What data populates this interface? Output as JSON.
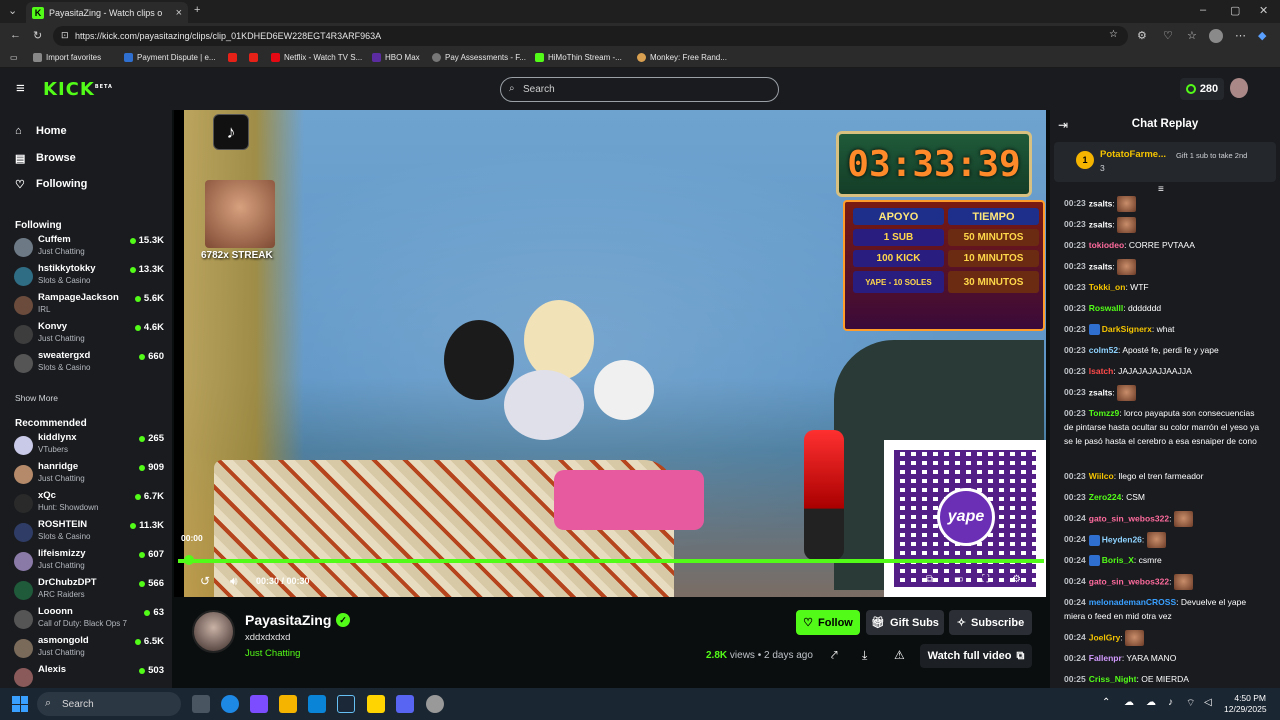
{
  "browser": {
    "tab_title": "PayasitaZing - Watch clips o",
    "url": "https://kick.com/payasitazing/clips/clip_01KDHED6EW228EGT4R3ARF963A",
    "favorites": [
      "Import favorites",
      "Payment Dispute | e...",
      "Netflix - Watch TV S...",
      "HBO Max",
      "Pay Assessments - F...",
      "HiMoThin Stream -...",
      "Monkey: Free Rand..."
    ]
  },
  "header": {
    "logo": "KICK",
    "logo_badge": "BETA",
    "search_placeholder": "Search",
    "points": "280"
  },
  "sidebar": {
    "nav": [
      {
        "label": "Home",
        "icon": "home-icon"
      },
      {
        "label": "Browse",
        "icon": "browse-icon"
      },
      {
        "label": "Following",
        "icon": "heart-icon"
      }
    ],
    "following_title": "Following",
    "following": [
      {
        "name": "Cuffem",
        "category": "Just Chatting",
        "viewers": "15.3K",
        "color": "#6d7a86"
      },
      {
        "name": "hstikkytokky",
        "category": "Slots & Casino",
        "viewers": "13.3K",
        "color": "#2f6d84"
      },
      {
        "name": "RampageJackson",
        "category": "IRL",
        "viewers": "5.6K",
        "color": "#6a4b3c"
      },
      {
        "name": "Konvy",
        "category": "Just Chatting",
        "viewers": "4.6K",
        "color": "#3d3d3d"
      },
      {
        "name": "sweatergxd",
        "category": "Slots & Casino",
        "viewers": "660",
        "color": "#555"
      }
    ],
    "show_more": "Show More",
    "recommended_title": "Recommended",
    "recommended": [
      {
        "name": "kiddlynx",
        "category": "VTubers",
        "viewers": "265",
        "color": "#c9c9e8"
      },
      {
        "name": "hanridge",
        "category": "Just Chatting",
        "viewers": "909",
        "color": "#b58a6a"
      },
      {
        "name": "xQc",
        "category": "Hunt: Showdown",
        "viewers": "6.7K",
        "color": "#2a2a2a"
      },
      {
        "name": "ROSHTEIN",
        "category": "Slots & Casino",
        "viewers": "11.3K",
        "color": "#2f3d66"
      },
      {
        "name": "lifeismizzy",
        "category": "Just Chatting",
        "viewers": "607",
        "color": "#8a7aa8"
      },
      {
        "name": "DrChubzDPT",
        "category": "ARC Raiders",
        "viewers": "566",
        "color": "#1f5a3a"
      },
      {
        "name": "Looonn",
        "category": "Call of Duty: Black Ops 7",
        "viewers": "63",
        "color": "#555"
      },
      {
        "name": "asmongold",
        "category": "Just Chatting",
        "viewers": "6.5K",
        "color": "#7a6a5a"
      },
      {
        "name": "Alexis",
        "category": "",
        "viewers": "503",
        "color": "#8a5a5a"
      }
    ]
  },
  "player": {
    "streak": "6782x STREAK",
    "timer": "03:33:39",
    "tariff": {
      "head": [
        "APOYO",
        "TIEMPO"
      ],
      "rows": [
        [
          "1 SUB",
          "50 MINUTOS"
        ],
        [
          "100 KICK",
          "10 MINUTOS"
        ],
        [
          "YAPE - 10 SOLES",
          "30 MINUTOS"
        ]
      ]
    },
    "qr_logo": "yape",
    "time_start": "00:00",
    "time_display": "00:30 / 00:30",
    "progress_fraction": 1.0
  },
  "clip": {
    "channel": "PayasitaZing",
    "title": "xddxdxdxd",
    "category": "Just Chatting",
    "follow": "Follow",
    "gift": "Gift Subs",
    "subscribe": "Subscribe",
    "views": "2.8K",
    "views_suffix": "views",
    "age": "2 days ago",
    "watch_full": "Watch full video"
  },
  "chat": {
    "title": "Chat Replay",
    "pinned": {
      "rank": "1",
      "name": "PotatoFarme...",
      "count": "3",
      "gift_text": "Gift 1 sub to take 2nd"
    },
    "messages": [
      {
        "time": "00:23",
        "user": "zsalts",
        "color": "#ffffff",
        "text": "",
        "emote": true
      },
      {
        "time": "00:23",
        "user": "zsalts",
        "color": "#ffffff",
        "text": "",
        "emote": true
      },
      {
        "time": "00:23",
        "user": "tokiodeo",
        "color": "#ff6b9d",
        "text": "CORRE PVTAAA",
        "emote": false
      },
      {
        "time": "00:23",
        "user": "zsalts",
        "color": "#ffffff",
        "text": "",
        "emote": true
      },
      {
        "time": "00:23",
        "user": "Tokki_on",
        "color": "#f5c400",
        "text": "WTF",
        "emote": false
      },
      {
        "time": "00:23",
        "user": "Roswalll",
        "color": "#53fc18",
        "text": "ddddddd",
        "emote": false
      },
      {
        "time": "00:23",
        "user": "DarkSignerx",
        "color": "#f5c400",
        "text": "what",
        "emote": false,
        "badges": true
      },
      {
        "time": "00:23",
        "user": "colm52",
        "color": "#8fd3ff",
        "text": "Aposté fe, perdi fe y yape",
        "emote": false
      },
      {
        "time": "00:23",
        "user": "lsatch",
        "color": "#ff4a4a",
        "text": "JAJAJAJAJJAAJJA",
        "emote": false
      },
      {
        "time": "00:23",
        "user": "zsalts",
        "color": "#ffffff",
        "text": "",
        "emote": true
      },
      {
        "time": "00:23",
        "user": "Tomzz9",
        "color": "#53fc18",
        "text": "lorco payaputa son consecuencias de pintarse hasta ocultar su color marrón el yeso ya se le pasó hasta el cerebro a esa esnaiper de cono",
        "emote": false
      },
      {
        "time": "00:23",
        "user": "Wiilco",
        "color": "#f5c400",
        "text": "llego el tren farmeador",
        "emote": false
      },
      {
        "time": "00:23",
        "user": "Zero224",
        "color": "#53fc18",
        "text": "CSM",
        "emote": false
      },
      {
        "time": "00:24",
        "user": "gato_sin_webos322",
        "color": "#ff6b9d",
        "text": "",
        "emote": true
      },
      {
        "time": "00:24",
        "user": "Heyden26",
        "color": "#8fd3ff",
        "text": "",
        "emote": true,
        "badges": true
      },
      {
        "time": "00:24",
        "user": "Boris_X",
        "color": "#53fc18",
        "text": "csmre",
        "emote": false,
        "badges": true
      },
      {
        "time": "00:24",
        "user": "gato_sin_webos322",
        "color": "#ff6b9d",
        "text": "",
        "emote": true
      },
      {
        "time": "00:24",
        "user": "melonademanCROSS",
        "color": "#3aa0ff",
        "text": "Devuelve el yape miera o feed en mid otra vez",
        "emote": false
      },
      {
        "time": "00:24",
        "user": "JoelGry",
        "color": "#f5c400",
        "text": "",
        "emote": true
      },
      {
        "time": "00:24",
        "user": "Fallenpr",
        "color": "#d39bff",
        "text": "YARA MANO",
        "emote": false
      },
      {
        "time": "00:25",
        "user": "Criss_Night",
        "color": "#53fc18",
        "text": "OE MIERDA",
        "emote": false
      }
    ]
  },
  "taskbar": {
    "search": "Search",
    "time": "4:50 PM",
    "date": "12/29/2025"
  }
}
